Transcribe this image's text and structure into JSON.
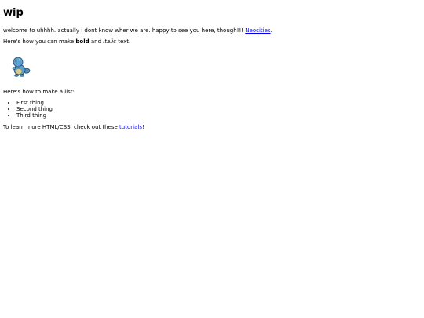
{
  "page": {
    "title": "wip",
    "welcome_text": "welcome to uhhhh. actually i dont know wher we are. happy to see you here, though!!! ",
    "welcome_link": "Neocities",
    "welcome_end": ".",
    "format_intro": "Here's how you can make ",
    "format_bold": "bold",
    "format_and": " and ",
    "format_italic": "italic",
    "format_end": " text.",
    "sprite_icon": "water-pokemon-sprite-icon",
    "list_intro": "Here's how to make a list:",
    "list_items": [
      "First thing",
      "Second thing",
      "Third thing"
    ],
    "learn_text": "To learn more HTML/CSS, check out these ",
    "learn_link": "tutorials",
    "learn_end": "!"
  },
  "colors": {
    "link": "#0000ee",
    "text": "#000000",
    "background": "#ffffff"
  }
}
